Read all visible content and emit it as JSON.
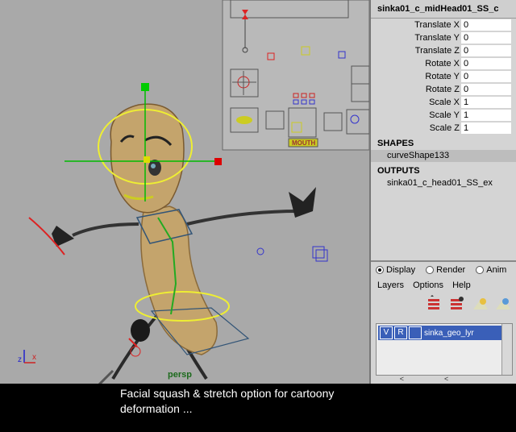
{
  "viewport": {
    "camera_label": "persp",
    "axis_z": "z",
    "axis_x": "x",
    "picker_mouth_label": "MOUTH"
  },
  "channel_box": {
    "object_name": "sinka01_c_midHead01_SS_c",
    "attributes": [
      {
        "label": "Translate X",
        "value": "0"
      },
      {
        "label": "Translate Y",
        "value": "0"
      },
      {
        "label": "Translate Z",
        "value": "0"
      },
      {
        "label": "Rotate X",
        "value": "0"
      },
      {
        "label": "Rotate Y",
        "value": "0"
      },
      {
        "label": "Rotate Z",
        "value": "0"
      },
      {
        "label": "Scale X",
        "value": "1"
      },
      {
        "label": "Scale Y",
        "value": "1"
      },
      {
        "label": "Scale Z",
        "value": "1"
      }
    ],
    "shapes_header": "SHAPES",
    "shape_name": "curveShape133",
    "outputs_header": "OUTPUTS",
    "output_name": "sinka01_c_head01_SS_ex"
  },
  "layer_editor": {
    "modes": [
      {
        "label": "Display",
        "selected": true
      },
      {
        "label": "Render",
        "selected": false
      },
      {
        "label": "Anim",
        "selected": false
      }
    ],
    "menus": [
      "Layers",
      "Options",
      "Help"
    ],
    "layer": {
      "v": "V",
      "r": "R",
      "name": "sinka_geo_lyr"
    },
    "scroll_left": "<<",
    "scroll_right": ">>"
  },
  "caption": {
    "line1": "Facial squash & stretch option for cartoony",
    "line2": "deformation ..."
  },
  "colors": {
    "viewport_bg": "#a9a9a9",
    "panel_bg": "#d4d4d4",
    "layer_selected": "#3a5fb8",
    "body_tan": "#c4a46c"
  }
}
